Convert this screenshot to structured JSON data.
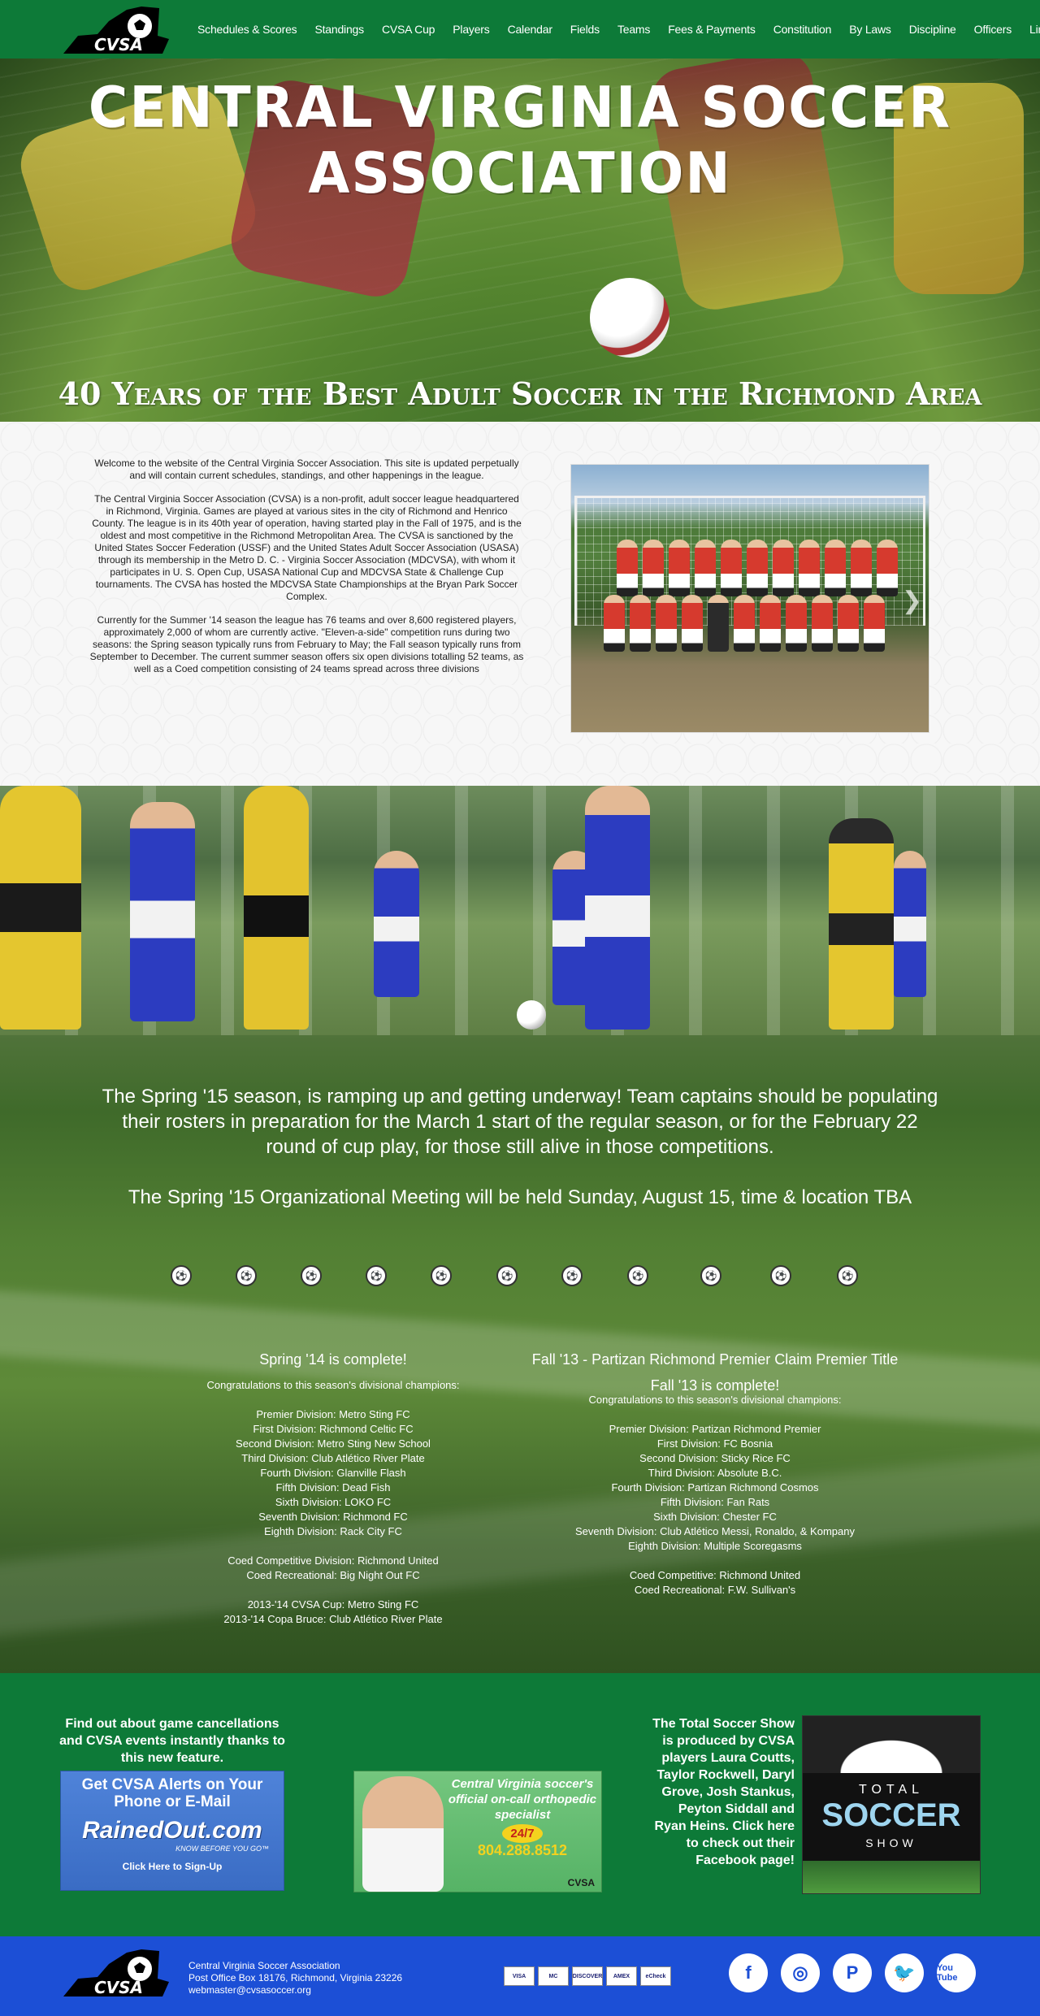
{
  "brand": {
    "logo_text": "CVSA",
    "green": "#0d7a38",
    "blue": "#1c4fd6"
  },
  "nav": {
    "items": [
      "Schedules & Scores",
      "Standings",
      "CVSA Cup",
      "Players",
      "Calendar",
      "Fields",
      "Teams",
      "Fees & Payments",
      "Constitution",
      "By Laws",
      "Discipline",
      "Officers",
      "Links"
    ]
  },
  "hero": {
    "title": "CENTRAL VIRGINIA SOCCER ASSOCIATION",
    "tagline": "40 Years of the Best Adult Soccer in the Richmond Area"
  },
  "welcome": {
    "intro": "Welcome to the website of the Central Virginia Soccer Association. This site is updated perpetually and will contain current schedules, standings, and other happenings in the league.",
    "about": "The Central Virginia Soccer Association (CVSA) is a non-profit, adult soccer league headquartered in Richmond, Virginia. Games are played at various sites in the city of Richmond and Henrico County. The league is in its 40th year of operation, having started play in the Fall of 1975, and is the oldest and most competitive in the Richmond Metropolitan Area. The CVSA is sanctioned by the United States Soccer Federation (USSF) and the United States Adult Soccer Association (USASA) through its membership in the Metro D. C. - Virginia Soccer Association (MDCVSA), with whom it participates in U. S. Open Cup, USASA National Cup and MDCVSA State & Challenge Cup tournaments. The CVSA has hosted the MDCVSA State Championships at the Bryan Park Soccer Complex.",
    "current": "Currently for the Summer '14 season the league has 76 teams and over 8,600 registered players, approximately 2,000 of whom are currently active. \"Eleven-a-side\" competition runs during two seasons: the Spring season typically runs from February to May; the Fall season typically runs from September to December. The current summer season offers six open divisions totalling 52 teams, as well as a Coed competition consisting of 24 teams spread across three divisions",
    "photo_arrow": "❯"
  },
  "season": {
    "announcement": "The Spring '15 season, is ramping up and getting underway! Team captains should be populating their rosters in preparation for the March 1 start of the regular season, or for the February 22 round of cup play, for those still alive in those competitions.",
    "meeting": "The Spring '15 Organizational Meeting will be held Sunday, August 15, time & location TBA",
    "ball_glyph": "⚽",
    "left": {
      "title": "Spring '14 is complete!",
      "congrats": "Congratulations to this season's divisional champions:",
      "divisions": [
        "Premier Division: Metro Sting FC",
        "First Division: Richmond Celtic FC",
        "Second Division: Metro Sting New School",
        "Third Division: Club Atlético River Plate",
        "Fourth Division: Glanville Flash",
        "Fifth Division: Dead Fish",
        "Sixth Division: LOKO FC",
        "Seventh Division: Richmond FC",
        "Eighth Division: Rack City FC"
      ],
      "coed": [
        "Coed Competitive Division: Richmond United",
        "Coed Recreational: Big Night Out FC"
      ],
      "cups": [
        "2013-'14 CVSA Cup: Metro Sting FC",
        "2013-'14 Copa Bruce: Club Atlético River Plate"
      ]
    },
    "right": {
      "headline": "Fall '13 - Partizan Richmond Premier Claim Premier Title",
      "title": "Fall '13 is complete!",
      "congrats": "Congratulations to this season's divisional champions:",
      "divisions": [
        "Premier Division: Partizan Richmond Premier",
        "First Division: FC Bosnia",
        "Second Division: Sticky Rice FC",
        "Third Division: Absolute B.C.",
        "Fourth Division: Partizan Richmond Cosmos",
        "Fifth Division: Fan Rats",
        "Sixth Division: Chester FC",
        "Seventh Division: Club Atlético Messi, Ronaldo, & Kompany",
        "Eighth Division: Multiple Scoregasms"
      ],
      "coed": [
        "Coed Competitive: Richmond United",
        "Coed Recreational: F.W. Sullivan's"
      ]
    }
  },
  "promo": {
    "alerts_text": "Find out about game cancellations and CVSA events instantly thanks to this new feature.",
    "rainedout": {
      "line1": "Get CVSA Alerts on Your Phone or E-Mail",
      "brand": "RainedOut.com",
      "tag": "KNOW BEFORE YOU GO™",
      "cta": "Click Here to Sign-Up"
    },
    "ortho": {
      "line1": "Central Virginia soccer's official on-call orthopedic specialist",
      "badge": "24/7",
      "phone": "804.288.8512",
      "logo": "CVSA"
    },
    "tss_text": "The Total Soccer Show is produced by CVSA players Laura Coutts, Taylor Rockwell, Daryl Grove, Josh Stankus, Peyton Siddall and Ryan Heins. Click here to check out their Facebook page!",
    "tss": {
      "total": "TOTAL",
      "soccer": "SOCCER",
      "show": "SHOW"
    }
  },
  "footer": {
    "org": "Central Virginia Soccer Association",
    "address": "Post Office Box 18176, Richmond, Virginia 23226",
    "email": "webmaster@cvsasoccer.org",
    "cards": [
      "VISA",
      "MC",
      "DISCOVER",
      "AMEX",
      "eCheck"
    ],
    "social": [
      {
        "name": "facebook",
        "glyph": "f"
      },
      {
        "name": "instagram",
        "glyph": "◎"
      },
      {
        "name": "pinterest",
        "glyph": "P"
      },
      {
        "name": "twitter",
        "glyph": "🐦"
      },
      {
        "name": "youtube",
        "glyph": "You Tube"
      }
    ]
  }
}
